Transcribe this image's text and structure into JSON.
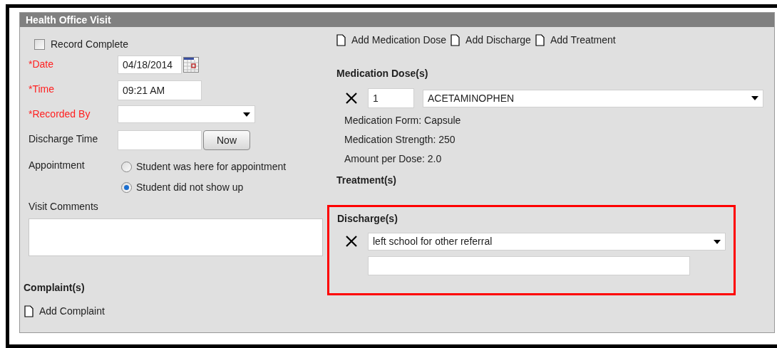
{
  "panel": {
    "title": "Health Office Visit"
  },
  "record_complete": {
    "label": "Record Complete",
    "checked": false
  },
  "fields": [
    {
      "label": "*Date",
      "required": true,
      "kind": "date",
      "value": "04/18/2014"
    },
    {
      "label": "*Time",
      "required": true,
      "kind": "text",
      "value": "09:21 AM"
    },
    {
      "label": "*Recorded By",
      "required": true,
      "kind": "select"
    },
    {
      "label": "Discharge Time",
      "required": false,
      "kind": "time",
      "button": "Now"
    }
  ],
  "appointment": {
    "label": "Appointment",
    "options": [
      {
        "label": "Student was here for appointment",
        "selected": false
      },
      {
        "label": "Student did not show up",
        "selected": true
      }
    ]
  },
  "visit_comments": {
    "label": "Visit Comments"
  },
  "complaints": {
    "heading": "Complaint(s)",
    "add_link": "Add Complaint"
  },
  "add_links": [
    "Add Medication Dose",
    "Add Discharge",
    "Add Treatment"
  ],
  "medication_doses": {
    "heading": "Medication Dose(s)",
    "items": [
      {
        "quantity": "1",
        "medication": "ACETAMINOPHEN",
        "details": [
          "Medication Form: Capsule",
          "Medication Strength: 250",
          "Amount per Dose: 2.0"
        ]
      }
    ]
  },
  "treatments": {
    "heading": "Treatment(s)"
  },
  "discharges": {
    "heading": "Discharge(s)",
    "highlighted": true,
    "items": [
      {
        "reason": "left school for other referral"
      }
    ]
  }
}
